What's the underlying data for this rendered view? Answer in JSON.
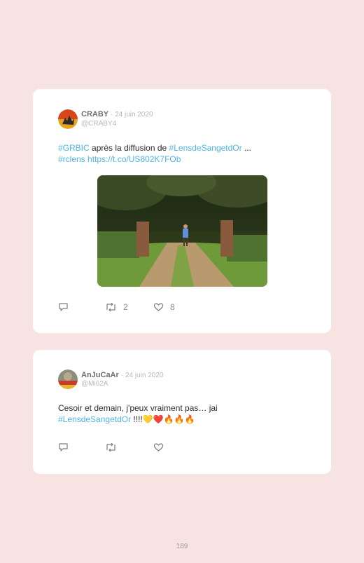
{
  "tweets": [
    {
      "author": "CRABY",
      "date": "· 24 juin 2020",
      "handle": "@CRABY4",
      "text": {
        "tag1": "#GRBIC",
        "mid1": " après la diffusion de ",
        "tag2": "#LensdeSangetdOr",
        "mid2": " ...",
        "tag3": "#rclens",
        "link": " https://t.co/US802K7FOb"
      },
      "has_media": true,
      "reply_count": "",
      "retweet_count": "2",
      "like_count": "8"
    },
    {
      "author": "AnJuCaAr",
      "date": "· 24 juin 2020",
      "handle": "@Mi62A",
      "text": {
        "line1": "Cesoir et demain, j'peux vraiment pas… jai",
        "tag1": "#LensdeSangetdOr",
        "tail": " !!!!💛❤️🔥🔥🔥"
      },
      "has_media": false,
      "reply_count": "",
      "retweet_count": "",
      "like_count": ""
    }
  ],
  "page_number": "189",
  "colors": {
    "background": "#f6e3e2",
    "card": "#ffffff",
    "hashtag": "#4fb4e7",
    "meta": "#b8b8b8",
    "icon": "#8c8c8c"
  },
  "icons": [
    "reply-icon",
    "retweet-icon",
    "like-icon"
  ]
}
